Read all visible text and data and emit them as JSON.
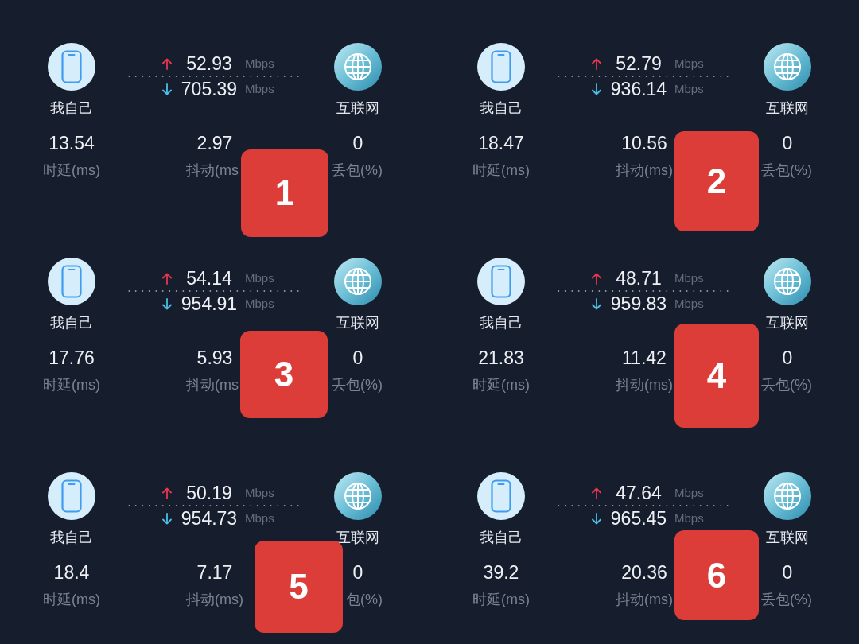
{
  "panels": [
    {
      "device_label": "我自己",
      "internet_label": "互联网",
      "upload": {
        "value": "52.93",
        "unit": "Mbps"
      },
      "download": {
        "value": "705.39",
        "unit": "Mbps"
      },
      "stats": [
        {
          "value": "13.54",
          "label": "时延(ms)"
        },
        {
          "value": "2.97",
          "label": "抖动(ms"
        },
        {
          "value": "0",
          "label": "丢包(%)"
        }
      ],
      "badge": "1"
    },
    {
      "device_label": "我自己",
      "internet_label": "互联网",
      "upload": {
        "value": "52.79",
        "unit": "Mbps"
      },
      "download": {
        "value": "936.14",
        "unit": "Mbps"
      },
      "stats": [
        {
          "value": "18.47",
          "label": "时延(ms)"
        },
        {
          "value": "10.56",
          "label": "抖动(ms)"
        },
        {
          "value": "0",
          "label": "丢包(%)"
        }
      ],
      "badge": "2"
    },
    {
      "device_label": "我自己",
      "internet_label": "互联网",
      "upload": {
        "value": "54.14",
        "unit": "Mbps"
      },
      "download": {
        "value": "954.91",
        "unit": "Mbps"
      },
      "stats": [
        {
          "value": "17.76",
          "label": "时延(ms)"
        },
        {
          "value": "5.93",
          "label": "抖动(ms"
        },
        {
          "value": "0",
          "label": "丢包(%)"
        }
      ],
      "badge": "3"
    },
    {
      "device_label": "我自己",
      "internet_label": "互联网",
      "upload": {
        "value": "48.71",
        "unit": "Mbps"
      },
      "download": {
        "value": "959.83",
        "unit": "Mbps"
      },
      "stats": [
        {
          "value": "21.83",
          "label": "时延(ms)"
        },
        {
          "value": "11.42",
          "label": "抖动(ms)"
        },
        {
          "value": "0",
          "label": "丢包(%)"
        }
      ],
      "badge": "4"
    },
    {
      "device_label": "我自己",
      "internet_label": "互联网",
      "upload": {
        "value": "50.19",
        "unit": "Mbps"
      },
      "download": {
        "value": "954.73",
        "unit": "Mbps"
      },
      "stats": [
        {
          "value": "18.4",
          "label": "时延(ms)"
        },
        {
          "value": "7.17",
          "label": "抖动(ms)"
        },
        {
          "value": "0",
          "label": "包(%)"
        }
      ],
      "badge": "5"
    },
    {
      "device_label": "我自己",
      "internet_label": "互联网",
      "upload": {
        "value": "47.64",
        "unit": "Mbps"
      },
      "download": {
        "value": "965.45",
        "unit": "Mbps"
      },
      "stats": [
        {
          "value": "39.2",
          "label": "时延(ms)"
        },
        {
          "value": "20.36",
          "label": "抖动(ms)"
        },
        {
          "value": "0",
          "label": "丢包(%)"
        }
      ],
      "badge": "6"
    }
  ]
}
